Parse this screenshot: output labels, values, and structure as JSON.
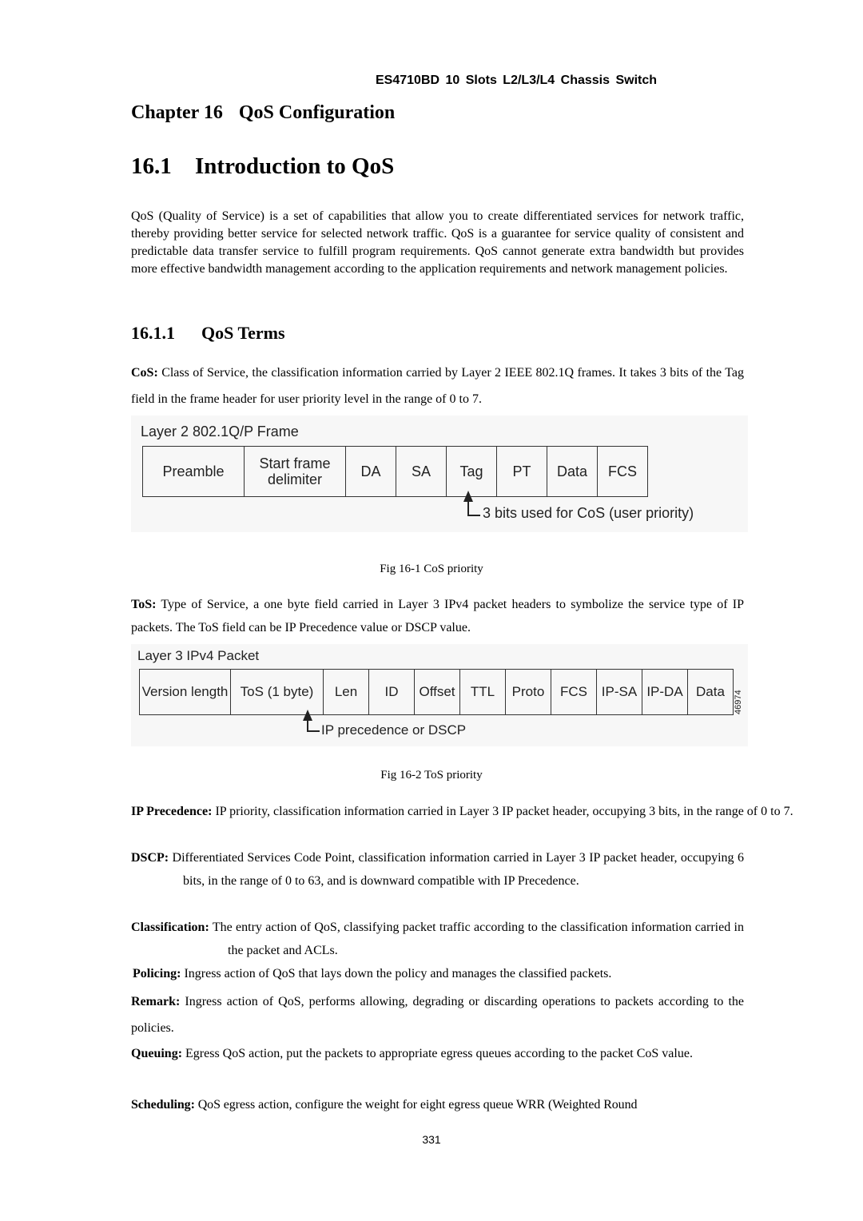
{
  "header": "ES4710BD 10 Slots L2/L3/L4 Chassis Switch",
  "chapter": {
    "label": "Chapter 16",
    "title": "QoS Configuration"
  },
  "section": {
    "number": "16.1",
    "title": "Introduction to QoS"
  },
  "intro": "QoS (Quality of Service) is a set of capabilities that allow you to create differentiated services for network traffic, thereby providing better service for selected network traffic. QoS is a guarantee for service quality of consistent and predictable data transfer service to fulfill program requirements. QoS cannot generate extra bandwidth but provides more effective bandwidth management according to the application requirements and network management policies.",
  "subsection": {
    "number": "16.1.1",
    "title": "QoS Terms"
  },
  "cos": {
    "term": "CoS:",
    "text": " Class of Service, the classification information carried by Layer 2 IEEE 802.1Q frames. It takes 3 bits of the Tag field in the frame header for user priority level in the range of 0 to 7."
  },
  "fig1": {
    "title": "Layer 2 802.1Q/P Frame",
    "cells": [
      "Preamble",
      "Start frame delimiter",
      "DA",
      "SA",
      "Tag",
      "PT",
      "Data",
      "FCS"
    ],
    "note": "3 bits used for CoS (user priority)",
    "caption": "Fig 16-1 CoS priority"
  },
  "tos": {
    "term": "ToS:",
    "text": " Type of Service, a one byte field carried in Layer 3 IPv4 packet headers to symbolize the service type of IP packets. The ToS field can be IP Precedence value or DSCP value."
  },
  "fig2": {
    "title": "Layer 3 IPv4 Packet",
    "cells": [
      "Version length",
      "ToS (1 byte)",
      "Len",
      "ID",
      "Offset",
      "TTL",
      "Proto",
      "FCS",
      "IP-SA",
      "IP-DA",
      "Data"
    ],
    "note": "IP precedence or DSCP",
    "side_id": "46974",
    "caption": "Fig 16-2 ToS priority"
  },
  "terms": [
    {
      "term": "IP Precedence:",
      "text": " IP priority, classification information carried in Layer 3 IP packet header, occupying 3 bits, in the range of 0 to 7."
    },
    {
      "term": "DSCP:",
      "text": " Differentiated Services Code Point, classification information carried in Layer 3 IP packet header, occupying 6 bits, in the range of 0 to 63, and is downward compatible with IP Precedence."
    },
    {
      "term": "Classification:",
      "text": " The entry action of QoS, classifying packet traffic according to the classification information carried in the packet and ACLs."
    },
    {
      "term": "Policing:",
      "text": " Ingress action of QoS that lays down the policy and manages the classified packets."
    },
    {
      "term": "Remark:",
      "text": " Ingress action of QoS, performs allowing, degrading or discarding operations to packets according to the policies."
    },
    {
      "term": "Queuing:",
      "text": " Egress QoS action, put the packets to appropriate egress queues according to the packet CoS value."
    },
    {
      "term": "Scheduling:",
      "text": " QoS egress action, configure the weight for eight egress queue WRR (Weighted Round"
    }
  ],
  "page_number": "331"
}
